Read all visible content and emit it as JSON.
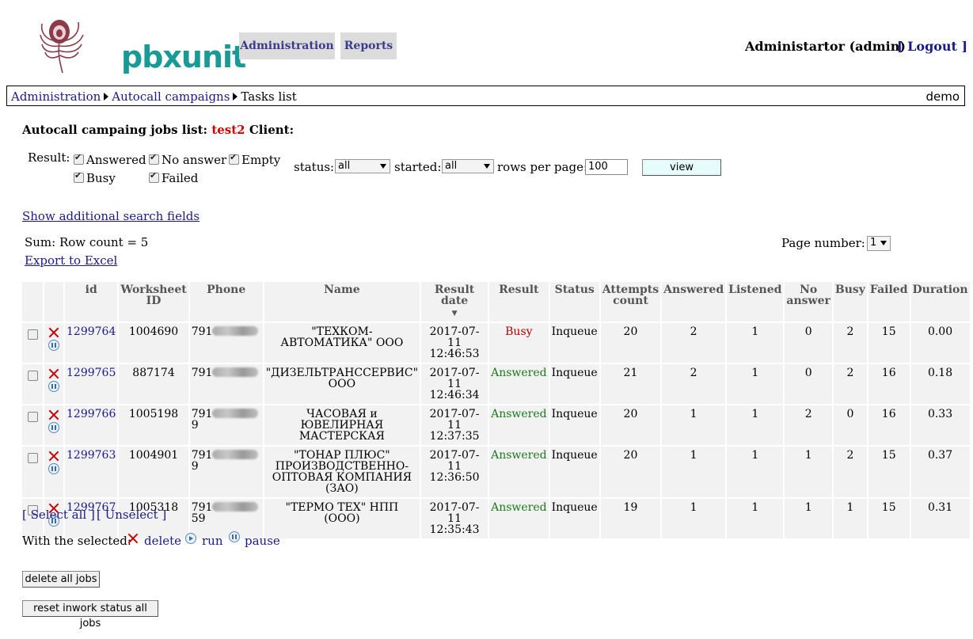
{
  "header": {
    "logo_text": "pbxunit",
    "nav": [
      "Administration",
      "Reports"
    ],
    "user": "Administartor (admin)",
    "logout": "[ Logout ]"
  },
  "breadcrumb": {
    "items": [
      "Administration",
      "Autocall campaigns"
    ],
    "current": "Tasks list",
    "right": "demo"
  },
  "title": {
    "prefix": "Autocall campaing jobs list:",
    "campaign": "test2",
    "client_label": "Client:"
  },
  "filters": {
    "result_label": "Result:",
    "results": [
      {
        "label": "Answered",
        "checked": true
      },
      {
        "label": "No answer",
        "checked": true
      },
      {
        "label": "Empty",
        "checked": true
      },
      {
        "label": "Busy",
        "checked": true
      },
      {
        "label": "Failed",
        "checked": true
      }
    ],
    "status_label": "status:",
    "status_value": "all",
    "started_label": "started:",
    "started_value": "all",
    "rows_label": "rows per page:",
    "rows_value": "100",
    "view_button": "view",
    "additional_link": "Show additional search fields"
  },
  "summary": {
    "sum": "Sum: Row count = 5",
    "export": "Export to Excel",
    "page_label": "Page number:",
    "page_value": "1"
  },
  "table": {
    "columns": [
      "id",
      "Worksheet ID",
      "Phone",
      "Name",
      "Result date",
      "Result",
      "Status",
      "Attempts count",
      "Answered",
      "Listened",
      "No answer",
      "Busy",
      "Failed",
      "Duration"
    ],
    "sort_indicator": "▼",
    "rows": [
      {
        "id": "1299764",
        "worksheet": "1004690",
        "phone_prefix": "791",
        "phone_suffix": "",
        "name": "\"ТЕХКОМ-АВТОМАТИКА\" ООО",
        "date": "2017-07-11",
        "time": "12:46:53",
        "result": "Busy",
        "status": "Inqueue",
        "attempts": "20",
        "answered": "2",
        "listened": "1",
        "noanswer": "0",
        "busy": "2",
        "failed": "15",
        "duration": "0.00"
      },
      {
        "id": "1299765",
        "worksheet": "887174",
        "phone_prefix": "791",
        "phone_suffix": "",
        "name": "\"ДИЗЕЛЬТРАНССЕРВИС\" ООО",
        "date": "2017-07-11",
        "time": "12:46:34",
        "result": "Answered",
        "status": "Inqueue",
        "attempts": "21",
        "answered": "2",
        "listened": "1",
        "noanswer": "0",
        "busy": "2",
        "failed": "16",
        "duration": "0.18"
      },
      {
        "id": "1299766",
        "worksheet": "1005198",
        "phone_prefix": "791",
        "phone_suffix": "9",
        "name": "ЧАСОВАЯ и ЮВЕЛИРНАЯ МАСТЕРСКАЯ",
        "date": "2017-07-11",
        "time": "12:37:35",
        "result": "Answered",
        "status": "Inqueue",
        "attempts": "20",
        "answered": "1",
        "listened": "1",
        "noanswer": "2",
        "busy": "0",
        "failed": "16",
        "duration": "0.33"
      },
      {
        "id": "1299763",
        "worksheet": "1004901",
        "phone_prefix": "791",
        "phone_suffix": "9",
        "name": "\"ТОНАР ПЛЮС\" ПРОИЗВОДСТВЕННО-ОПТОВАЯ КОМПАНИЯ (ЗАО)",
        "date": "2017-07-11",
        "time": "12:36:50",
        "result": "Answered",
        "status": "Inqueue",
        "attempts": "20",
        "answered": "1",
        "listened": "1",
        "noanswer": "1",
        "busy": "2",
        "failed": "15",
        "duration": "0.37"
      },
      {
        "id": "1299767",
        "worksheet": "1005318",
        "phone_prefix": "791",
        "phone_suffix": "59",
        "name": "\"ТЕРМО ТЕХ\" НПП (ООО)",
        "date": "2017-07-11",
        "time": "12:35:43",
        "result": "Answered",
        "status": "Inqueue",
        "attempts": "19",
        "answered": "1",
        "listened": "1",
        "noanswer": "1",
        "busy": "1",
        "failed": "15",
        "duration": "0.31"
      }
    ]
  },
  "footer": {
    "select_all": "[ Select all ]",
    "unselect": "[ Unselect ]",
    "with_selected": "With the selected:",
    "delete": "delete",
    "run": "run",
    "pause": "pause",
    "delete_all_button": "delete all jobs",
    "reset_button": "reset inwork status all jobs"
  },
  "colors": {
    "brand": "#1a9a96",
    "campaign": "#d40000",
    "busy": "#b30000",
    "answered": "#1a7a1a",
    "link": "#1a1a8c"
  }
}
